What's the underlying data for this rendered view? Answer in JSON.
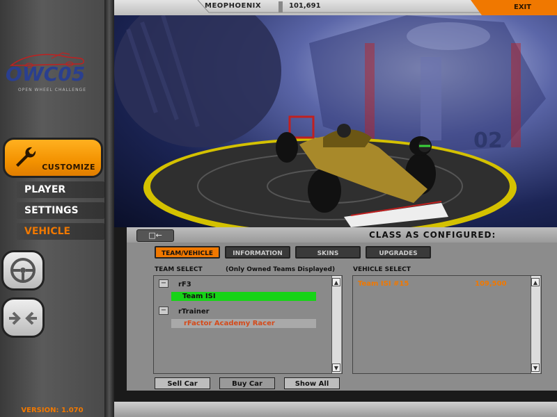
{
  "header": {
    "player_name": "MEOPHOENIX",
    "money": "101,691",
    "exit_label": "EXIT"
  },
  "logo": {
    "main": "OWC05",
    "subtitle": "OPEN WHEEL CHALLENGE"
  },
  "sidebar": {
    "customize_label": "CUSTOMIZE",
    "items": [
      {
        "label": "PLAYER",
        "color": "#ffffff"
      },
      {
        "label": "SETTINGS",
        "color": "#ffffff"
      },
      {
        "label": "VEHICLE",
        "color": "#f07800"
      }
    ],
    "version": "VERSION: 1.070"
  },
  "scene": {
    "car_number": "02"
  },
  "panel": {
    "back_icon": "back-arrow-icon",
    "title": "CLASS AS CONFIGURED:",
    "tabs": [
      {
        "label": "TEAM/VEHICLE",
        "active": true
      },
      {
        "label": "INFORMATION",
        "active": false
      },
      {
        "label": "SKINS",
        "active": false
      },
      {
        "label": "UPGRADES",
        "active": false
      }
    ],
    "team_select": {
      "label": "TEAM SELECT",
      "note": "(Only Owned Teams Displayed)",
      "groups": [
        {
          "name": "rF3",
          "items": [
            {
              "label": "Team ISI",
              "selected": true
            }
          ]
        },
        {
          "name": "rTrainer",
          "items": [
            {
              "label": "rFactor Academy Racer",
              "selected": false
            }
          ]
        }
      ]
    },
    "vehicle_select": {
      "label": "VEHICLE SELECT",
      "items": [
        {
          "name": "Team ISI #15",
          "price": "109,500"
        }
      ]
    },
    "buttons": {
      "sell": "Sell Car",
      "buy": "Buy Car",
      "show_all": "Show All"
    }
  },
  "colors": {
    "accent": "#f07800",
    "selected": "#17d317"
  }
}
